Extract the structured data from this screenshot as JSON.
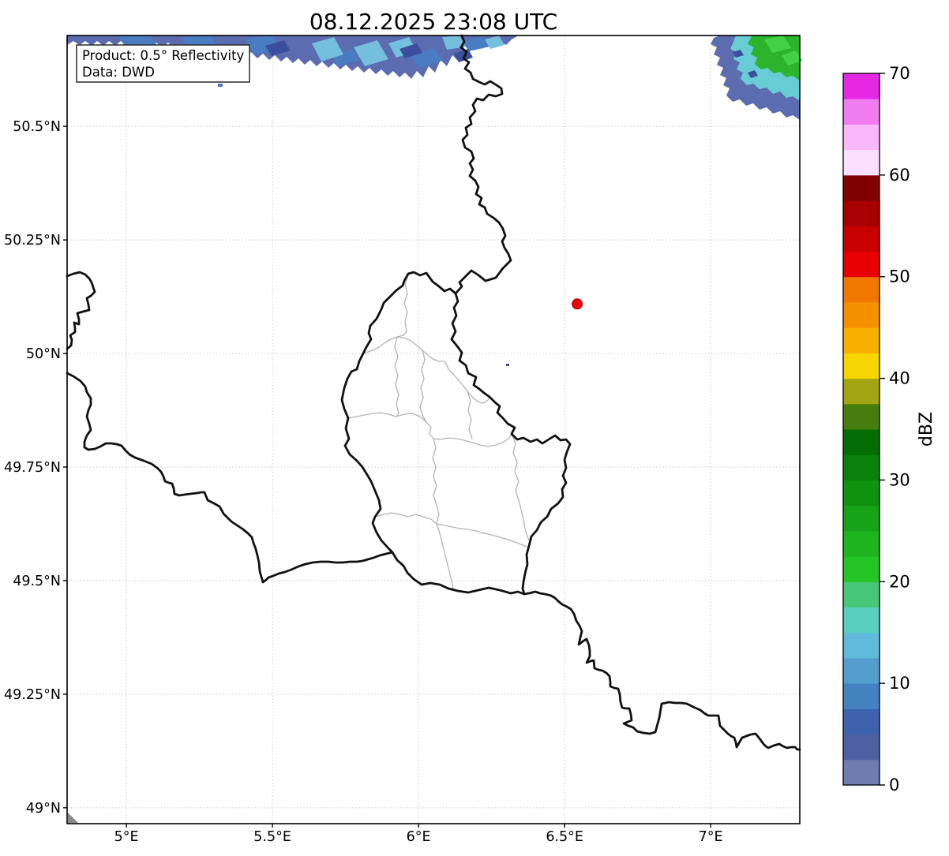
{
  "title": "08.12.2025 23:08 UTC",
  "product_box": {
    "line1": "Product: 0.5° Reflectivity",
    "line2": "Data: DWD"
  },
  "map": {
    "extent": {
      "lon_min": 4.797,
      "lon_max": 7.305,
      "lat_min": 48.965,
      "lat_max": 50.7
    },
    "x_ticks": [
      {
        "lon": 5.0,
        "label": "5°E"
      },
      {
        "lon": 5.5,
        "label": "5.5°E"
      },
      {
        "lon": 6.0,
        "label": "6°E"
      },
      {
        "lon": 6.5,
        "label": "6.5°E"
      },
      {
        "lon": 7.0,
        "label": "7°E"
      }
    ],
    "y_ticks": [
      {
        "lat": 50.5,
        "label": "50.5°N"
      },
      {
        "lat": 50.25,
        "label": "50.25°N"
      },
      {
        "lat": 50.0,
        "label": "50°N"
      },
      {
        "lat": 49.75,
        "label": "49.75°N"
      },
      {
        "lat": 49.5,
        "label": "49.5°N"
      },
      {
        "lat": 49.25,
        "label": "49.25°N"
      },
      {
        "lat": 49.0,
        "label": "49°N"
      }
    ]
  },
  "marker": {
    "lon": 6.543,
    "lat": 50.109,
    "color": "#e8000b",
    "edge_color": "#b30000"
  },
  "colorbar": {
    "label": "dBZ",
    "vmin": 0,
    "vmax": 70,
    "step": 2.5,
    "ticks": [
      {
        "value": 0,
        "label": "0"
      },
      {
        "value": 10,
        "label": "10"
      },
      {
        "value": 20,
        "label": "20"
      },
      {
        "value": 30,
        "label": "30"
      },
      {
        "value": 40,
        "label": "40"
      },
      {
        "value": 50,
        "label": "50"
      },
      {
        "value": 60,
        "label": "60"
      },
      {
        "value": 70,
        "label": "70"
      }
    ],
    "colors_bottom_to_top": [
      "#6e7cae",
      "#4f5fa3",
      "#3f62ae",
      "#4583c0",
      "#539ecf",
      "#60badc",
      "#58cfc0",
      "#46c878",
      "#24c424",
      "#1eb41e",
      "#17a317",
      "#109210",
      "#0a810a",
      "#046e04",
      "#467d0e",
      "#a3a414",
      "#f6d500",
      "#f7b000",
      "#f59000",
      "#f07800",
      "#e80000",
      "#c80000",
      "#a80000",
      "#7e0000",
      "#fcdffc",
      "#f9b8f9",
      "#f07df0",
      "#e428e4"
    ]
  },
  "echoes": {
    "band_base": "#5b6cb0",
    "band_mid": "#4a7cc2",
    "band_light": "#74bede",
    "band_dark": "#3b4f9e",
    "cell_green": "#2cb52c",
    "cell_green_bright": "#45d145",
    "cell_cyan": "#68ccd4"
  },
  "colors": {
    "country_border": "#111111",
    "canton_border": "#b3b3b3",
    "grid_line": "#c9c9c9",
    "axis": "#000000",
    "background": "#ffffff",
    "corner_wedge": "#8a8a8a"
  }
}
